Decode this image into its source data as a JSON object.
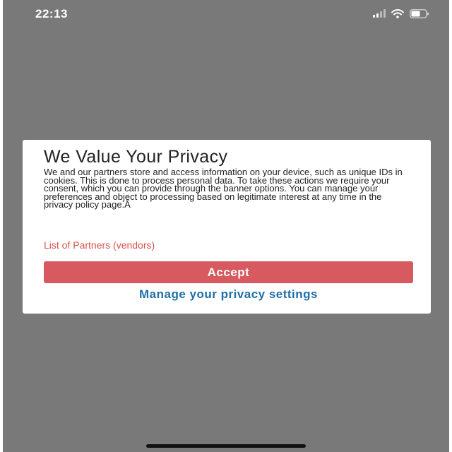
{
  "status_bar": {
    "time": "22:13",
    "icons": [
      "signal-icon",
      "wifi-icon",
      "battery-icon"
    ]
  },
  "consent_dialog": {
    "title": "We Value Your Privacy",
    "body": "We and our partners store and access information on your device, such as unique IDs in cookies. This is done to process personal data. To take these actions we require your consent, which you can provide through the banner options. You can manage your preferences and object to processing based on legitimate interest at any time in the privacy policy page.Â",
    "partners_link": "List of Partners (vendors)",
    "accept_label": "Accept",
    "manage_label": "Manage your privacy settings"
  },
  "colors": {
    "overlay": "#797979",
    "link_red": "#d9534f",
    "accept_button": "#d65a5f",
    "manage_blue": "#1e6fa8"
  }
}
